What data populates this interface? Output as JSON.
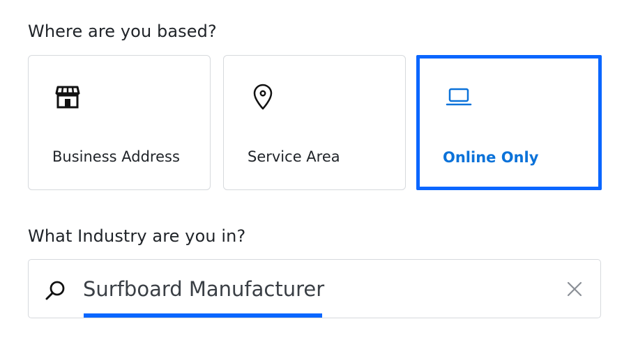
{
  "location": {
    "question": "Where are you based?",
    "options": [
      {
        "label": "Business Address",
        "icon": "storefront-icon",
        "selected": false
      },
      {
        "label": "Service Area",
        "icon": "map-pin-icon",
        "selected": false
      },
      {
        "label": "Online Only",
        "icon": "laptop-icon",
        "selected": true
      }
    ]
  },
  "industry": {
    "question": "What Industry are you in?",
    "search_value": "Surfboard Manufacturer",
    "search_icon": "search-icon",
    "clear_icon": "close-icon"
  },
  "colors": {
    "accent": "#0a66ff",
    "selected_text": "#0b72d9",
    "border": "#d6d9dd",
    "text": "#1f2328"
  }
}
